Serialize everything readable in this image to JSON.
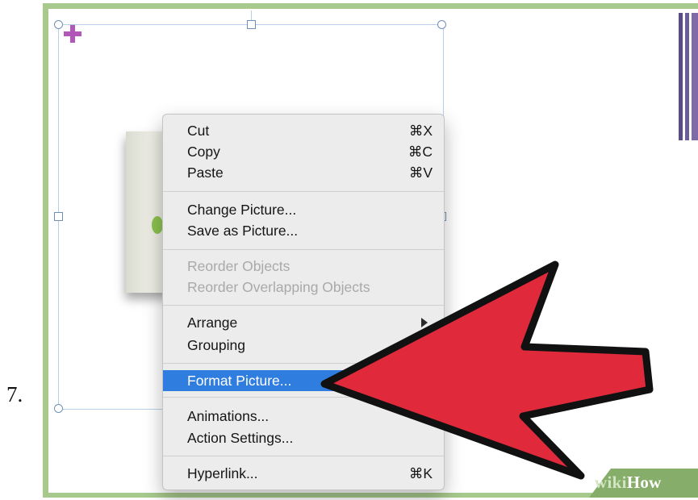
{
  "step_number": "7.",
  "context_menu": {
    "items": [
      {
        "label": "Cut",
        "shortcut": "⌘X",
        "enabled": true
      },
      {
        "label": "Copy",
        "shortcut": "⌘C",
        "enabled": true
      },
      {
        "label": "Paste",
        "shortcut": "⌘V",
        "enabled": true
      },
      {
        "label": "Change Picture...",
        "shortcut": "",
        "enabled": true
      },
      {
        "label": "Save as Picture...",
        "shortcut": "",
        "enabled": true
      },
      {
        "label": "Reorder Objects",
        "shortcut": "",
        "enabled": false
      },
      {
        "label": "Reorder Overlapping Objects",
        "shortcut": "",
        "enabled": false
      },
      {
        "label": "Arrange",
        "shortcut": "",
        "enabled": true,
        "submenu": true
      },
      {
        "label": "Grouping",
        "shortcut": "",
        "enabled": true
      },
      {
        "label": "Format Picture...",
        "shortcut": "",
        "enabled": true,
        "highlighted": true
      },
      {
        "label": "Animations...",
        "shortcut": "",
        "enabled": true
      },
      {
        "label": "Action Settings...",
        "shortcut": "",
        "enabled": true
      },
      {
        "label": "Hyperlink...",
        "shortcut": "⌘K",
        "enabled": true
      }
    ]
  },
  "watermark": {
    "part1": "wiki",
    "part2": "How"
  },
  "colors": {
    "frame_border": "#a7c98c",
    "highlight": "#2f7ddf",
    "arrow_fill": "#e02a3c",
    "plus_icon": "#b256b8",
    "watermark_bg": "#87ad6a"
  },
  "icons": {
    "move_cursor": "plus-icon",
    "pointer": "red-arrow-icon",
    "submenu": "submenu-arrow-icon"
  }
}
